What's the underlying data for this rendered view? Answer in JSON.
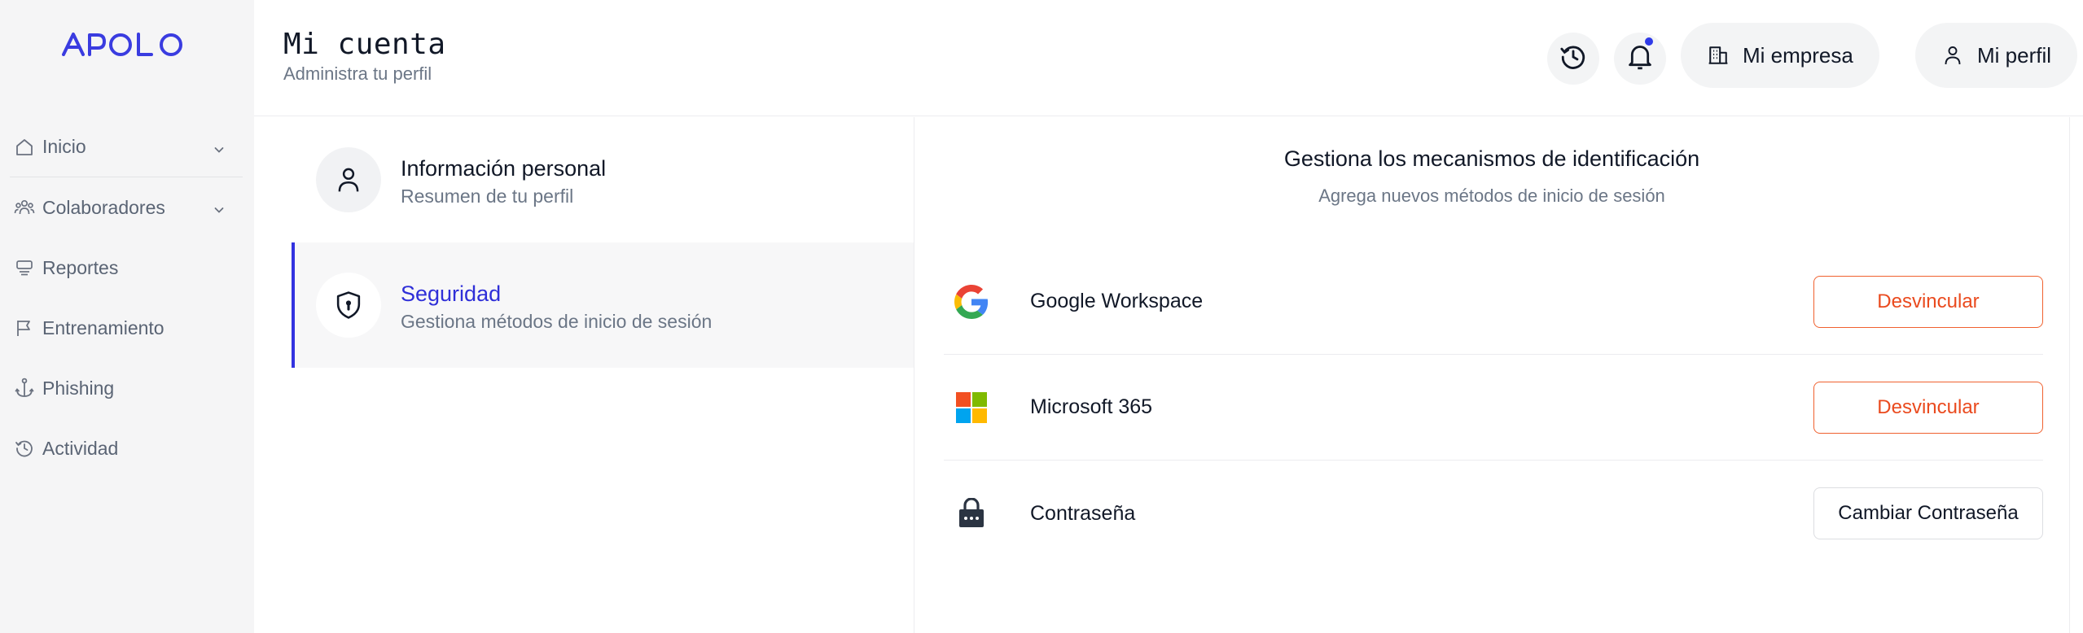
{
  "brand": {
    "logo_text": "APOLO",
    "accent": "#3a3ce0"
  },
  "sidebar": {
    "items": [
      {
        "label": "Inicio",
        "icon": "home-icon",
        "has_chevron": true
      },
      {
        "label": "Colaboradores",
        "icon": "users-icon",
        "has_chevron": true
      },
      {
        "label": "Reportes",
        "icon": "reports-icon",
        "has_chevron": false
      },
      {
        "label": "Entrenamiento",
        "icon": "flag-icon",
        "has_chevron": false
      },
      {
        "label": "Phishing",
        "icon": "anchor-icon",
        "has_chevron": false
      },
      {
        "label": "Actividad",
        "icon": "history-icon",
        "has_chevron": false
      }
    ]
  },
  "header": {
    "title": "Mi cuenta",
    "subtitle": "Administra tu perfil",
    "history_icon": "history-icon",
    "notifications_icon": "bell-icon",
    "company_button": "Mi empresa",
    "profile_button": "Mi perfil"
  },
  "account_menu": {
    "items": [
      {
        "title": "Información personal",
        "subtitle": "Resumen de tu perfil",
        "icon": "user-icon",
        "active": false
      },
      {
        "title": "Seguridad",
        "subtitle": "Gestiona métodos de inicio de sesión",
        "icon": "shield-icon",
        "active": true
      }
    ]
  },
  "security": {
    "title": "Gestiona los mecanismos de identificación",
    "subtitle": "Agrega nuevos métodos de inicio de sesión",
    "methods": [
      {
        "name": "Google Workspace",
        "icon": "google-icon",
        "action": "Desvincular"
      },
      {
        "name": "Microsoft 365",
        "icon": "microsoft-icon",
        "action": "Desvincular"
      },
      {
        "name": "Contraseña",
        "icon": "lock-icon",
        "action": "Cambiar Contraseña"
      }
    ]
  },
  "colors": {
    "danger": "#ea4a1e",
    "active": "#2f2fd8",
    "notification_dot": "#2f3ae8"
  }
}
